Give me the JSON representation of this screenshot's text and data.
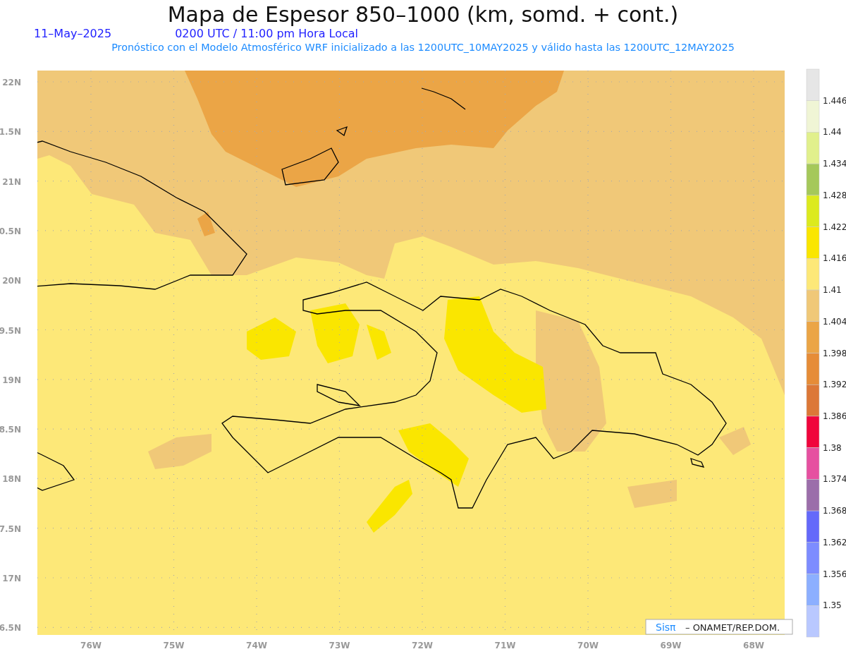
{
  "title": "Mapa de Espesor 850–1000 (km, somd. + cont.)",
  "date": "11–May–2025",
  "time": "0200 UTC / 11:00 pm Hora Local",
  "subtitle": "Pronóstico con el Modelo Atmosférico WRF inicializado a las 1200UTC_10MAY2025 y válido hasta las  1200UTC_12MAY2025",
  "lat_labels": [
    "22N",
    "1.5N",
    "21N",
    "0.5N",
    "20N",
    "9.5N",
    "19N",
    "8.5N",
    "18N",
    "7.5N",
    "17N",
    "6.5N"
  ],
  "lon_labels": [
    "76W",
    "75W",
    "74W",
    "73W",
    "72W",
    "71W",
    "70W",
    "69W",
    "68W"
  ],
  "colorbar": {
    "segments": [
      {
        "color": "#e6e6e6"
      },
      {
        "color": "#f0f5d5"
      },
      {
        "color": "#e1f08c"
      },
      {
        "color": "#a5c85a"
      },
      {
        "color": "#dcea1e"
      },
      {
        "color": "#fae600"
      },
      {
        "color": "#fde878"
      },
      {
        "color": "#f0c878"
      },
      {
        "color": "#eba546"
      },
      {
        "color": "#e68c37"
      },
      {
        "color": "#dc7837"
      },
      {
        "color": "#f0053c"
      },
      {
        "color": "#e650a0"
      },
      {
        "color": "#9b6eaa"
      },
      {
        "color": "#6469fa"
      },
      {
        "color": "#7d8cff"
      },
      {
        "color": "#8cafff"
      },
      {
        "color": "#b9c8ff"
      }
    ],
    "labels": [
      "1.446",
      "1.44",
      "1.434",
      "1.428",
      "1.422",
      "1.416",
      "1.41",
      "1.404",
      "1.398",
      "1.392",
      "1.386",
      "1.38",
      "1.374",
      "1.368",
      "1.362",
      "1.356",
      "1.35"
    ]
  },
  "credit": {
    "brand": "Sisπ",
    "text": "– ONAMET/REP.DOM."
  }
}
